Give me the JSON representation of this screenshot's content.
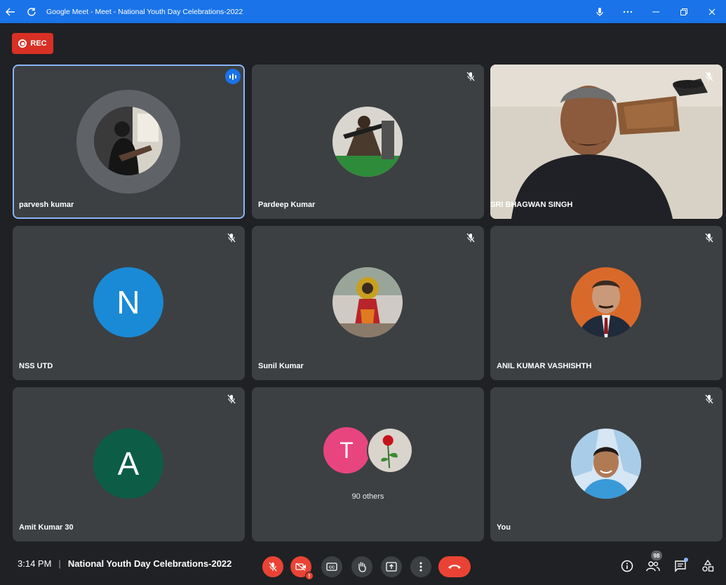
{
  "window": {
    "title": "Google Meet - Meet - National Youth Day Celebrations-2022"
  },
  "recording": {
    "label": "REC"
  },
  "tiles": [
    {
      "name": "parvesh kumar",
      "avatar": "photo",
      "speaking": true
    },
    {
      "name": "Pardeep Kumar",
      "avatar": "photo",
      "muted": true
    },
    {
      "name": "SRI BHAGWAN SINGH",
      "avatar": "video",
      "muted": true
    },
    {
      "name": "NSS UTD",
      "avatar_letter": "N",
      "avatar_color": "#1a8ad6",
      "muted": true
    },
    {
      "name": "Sunil Kumar",
      "avatar": "photo",
      "muted": true
    },
    {
      "name": "ANIL KUMAR VASHISHTH",
      "avatar": "photo",
      "muted": true
    },
    {
      "name": "Amit Kumar 30",
      "avatar_letter": "A",
      "avatar_color": "#0d5c46",
      "muted": true
    },
    {
      "others_letter": "T",
      "others_color": "#e8457f",
      "others_label": "90 others"
    },
    {
      "name": "You",
      "avatar": "photo",
      "muted": true
    }
  ],
  "bottom_bar": {
    "time": "3:14 PM",
    "separator": "|",
    "meeting_title": "National Youth Day Celebrations-2022",
    "participants_count": "98"
  },
  "colors": {
    "accent": "#1a73e8",
    "danger": "#ea4335",
    "tile_bg": "#3c4043",
    "page_bg": "#202124"
  }
}
